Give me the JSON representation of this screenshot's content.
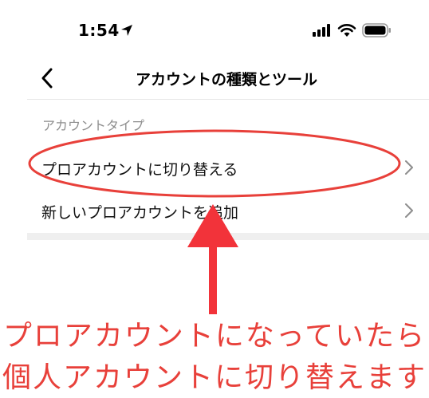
{
  "status_bar": {
    "time": "1:54"
  },
  "nav": {
    "title": "アカウントの種類とツール"
  },
  "section": {
    "header": "アカウントタイプ"
  },
  "rows": [
    {
      "label": "プロアカウントに切り替える"
    },
    {
      "label": "新しいプロアカウントを追加"
    }
  ],
  "annotation": {
    "line1": "プロアカウントになっていたら",
    "line2": "個人アカウントに切り替えます",
    "color": "#e8403a"
  }
}
